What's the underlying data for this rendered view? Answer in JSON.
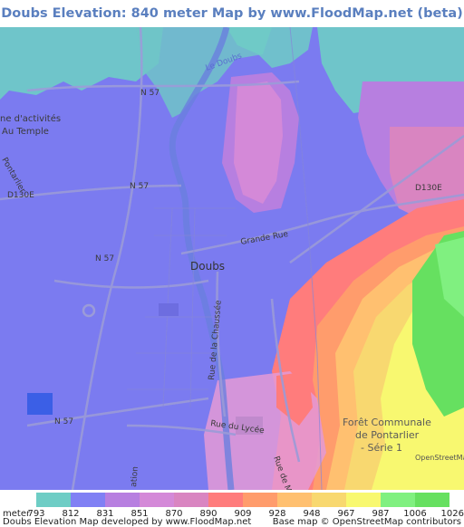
{
  "header": {
    "title": "Doubs Elevation: 840 meter Map by www.FloodMap.net (beta)"
  },
  "map": {
    "place_labels": [
      {
        "text": "Doubs",
        "name": "label-doubs"
      },
      {
        "text": "N 57",
        "name": "label-n57-north"
      },
      {
        "text": "N 57",
        "name": "label-n57-mid"
      },
      {
        "text": "N 57",
        "name": "label-n57-west"
      },
      {
        "text": "N 57",
        "name": "label-n57-south"
      },
      {
        "text": "D130E",
        "name": "label-d130e"
      },
      {
        "text": "D130E",
        "name": "label-d130e-east"
      },
      {
        "text": "Grande Rue",
        "name": "label-grande-rue"
      },
      {
        "text": "Rue de la Chaussée",
        "name": "label-rue-chaussee"
      },
      {
        "text": "Rue du Lycée",
        "name": "label-rue-lycee"
      },
      {
        "text": "Rue de M",
        "name": "label-rue-de-m"
      },
      {
        "text": "ation",
        "name": "label-ation"
      },
      {
        "text": "ne d'activités",
        "name": "label-zone-activites"
      },
      {
        "text": "Au Temple",
        "name": "label-au-temple"
      },
      {
        "text": "Pontarlier",
        "name": "label-pontarlier-road"
      },
      {
        "text": "Le Doubs",
        "name": "label-le-doubs-river"
      },
      {
        "text": "Forêt Communale",
        "name": "label-foret-1"
      },
      {
        "text": "de Pontarlier",
        "name": "label-foret-2"
      },
      {
        "text": "- Série 1",
        "name": "label-foret-3"
      },
      {
        "text": "OpenStreetMap",
        "name": "label-osm-watermark"
      }
    ]
  },
  "legend": {
    "unit": "meter",
    "ticks": [
      "793",
      "812",
      "831",
      "851",
      "870",
      "890",
      "909",
      "928",
      "948",
      "967",
      "987",
      "1006",
      "1026"
    ],
    "colors": [
      "#6ecdc5",
      "#8080f4",
      "#b77fe0",
      "#d489d8",
      "#d985c1",
      "#ff7c7c",
      "#ff9c6c",
      "#ffc070",
      "#f8d870",
      "#f8f870",
      "#80f080",
      "#66e060"
    ]
  },
  "footer": {
    "left": "Doubs Elevation Map developed by www.FloodMap.net",
    "right": "Base map © OpenStreetMap contributors"
  }
}
